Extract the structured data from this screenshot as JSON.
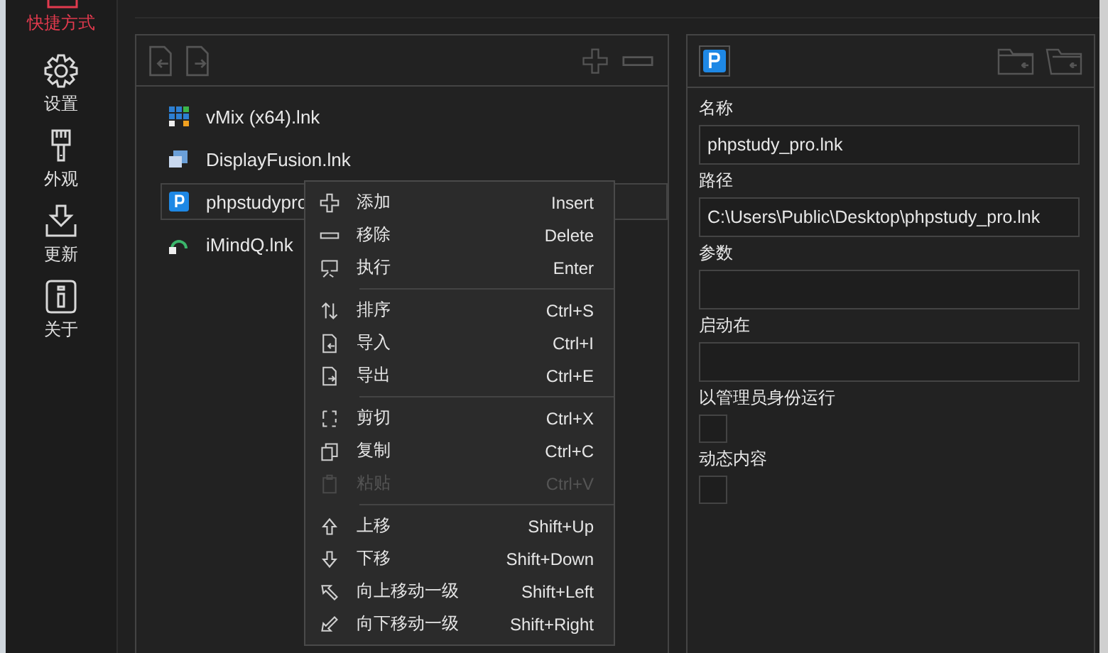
{
  "sidebar": {
    "items": [
      {
        "label": "快捷方式",
        "kind": "shortcut",
        "selected": true
      },
      {
        "label": "设置",
        "kind": "settings",
        "selected": false
      },
      {
        "label": "外观",
        "kind": "appearance",
        "selected": false
      },
      {
        "label": "更新",
        "kind": "update",
        "selected": false
      },
      {
        "label": "关于",
        "kind": "about",
        "selected": false
      }
    ]
  },
  "shortcut_list": {
    "items": [
      {
        "name": "vMix (x64).lnk",
        "kind": "vmix",
        "selected": false
      },
      {
        "name": "DisplayFusion.lnk",
        "kind": "displayfusion",
        "selected": false
      },
      {
        "name": "phpstudypro",
        "kind": "phpstudy",
        "selected": true
      },
      {
        "name": "iMindQ.lnk",
        "kind": "imindq",
        "selected": false
      }
    ]
  },
  "context_menu": {
    "groups": [
      {
        "items": [
          {
            "kind": "add",
            "label": "添加",
            "shortcut": "Insert",
            "disabled": false
          },
          {
            "kind": "remove",
            "label": "移除",
            "shortcut": "Delete",
            "disabled": false
          },
          {
            "kind": "run",
            "label": "执行",
            "shortcut": "Enter",
            "disabled": false
          }
        ]
      },
      {
        "items": [
          {
            "kind": "sort",
            "label": "排序",
            "shortcut": "Ctrl+S",
            "disabled": false
          },
          {
            "kind": "import",
            "label": "导入",
            "shortcut": "Ctrl+I",
            "disabled": false
          },
          {
            "kind": "export",
            "label": "导出",
            "shortcut": "Ctrl+E",
            "disabled": false
          }
        ]
      },
      {
        "items": [
          {
            "kind": "cut",
            "label": "剪切",
            "shortcut": "Ctrl+X",
            "disabled": false
          },
          {
            "kind": "copy",
            "label": "复制",
            "shortcut": "Ctrl+C",
            "disabled": false
          },
          {
            "kind": "paste",
            "label": "粘贴",
            "shortcut": "Ctrl+V",
            "disabled": true
          }
        ]
      },
      {
        "items": [
          {
            "kind": "up",
            "label": "上移",
            "shortcut": "Shift+Up",
            "disabled": false
          },
          {
            "kind": "down",
            "label": "下移",
            "shortcut": "Shift+Down",
            "disabled": false
          },
          {
            "kind": "level_up",
            "label": "向上移动一级",
            "shortcut": "Shift+Left",
            "disabled": false
          },
          {
            "kind": "level_down",
            "label": "向下移动一级",
            "shortcut": "Shift+Right",
            "disabled": false
          }
        ]
      }
    ]
  },
  "details": {
    "fields": [
      {
        "kind": "text",
        "label": "名称",
        "value": "phpstudy_pro.lnk"
      },
      {
        "kind": "text",
        "label": "路径",
        "value": "C:\\Users\\Public\\Desktop\\phpstudy_pro.lnk"
      },
      {
        "kind": "text",
        "label": "参数"
      },
      {
        "kind": "text",
        "label": "启动在"
      },
      {
        "kind": "checkbox",
        "label": "以管理员身份运行",
        "checked": false
      },
      {
        "kind": "checkbox",
        "label": "动态内容",
        "checked": false
      }
    ]
  }
}
